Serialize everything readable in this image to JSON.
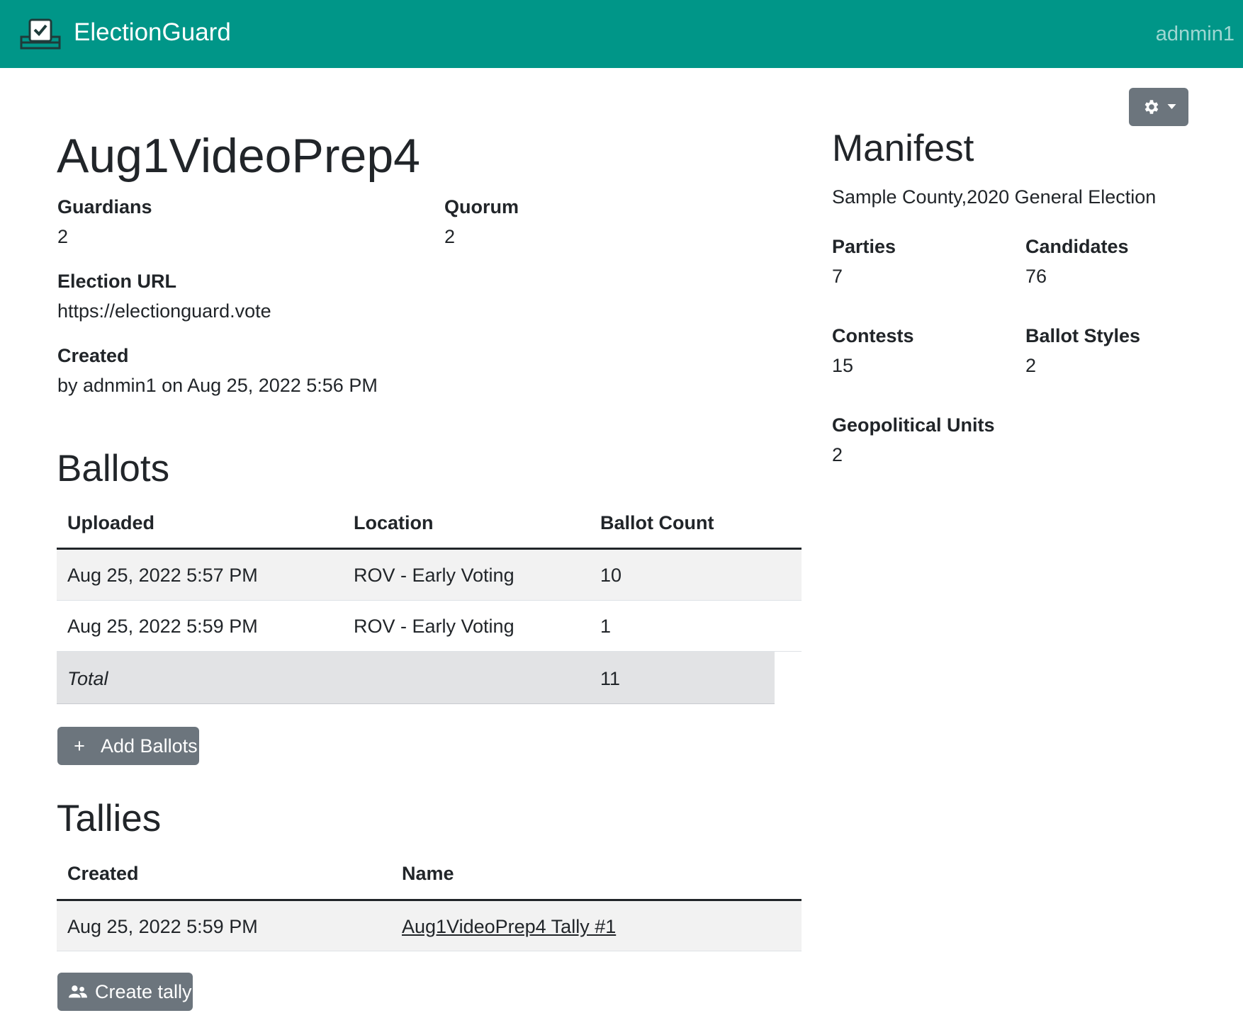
{
  "navbar": {
    "brand": "ElectionGuard",
    "user": "adnmin1"
  },
  "election": {
    "title": "Aug1VideoPrep4",
    "guardians_label": "Guardians",
    "guardians_value": "2",
    "quorum_label": "Quorum",
    "quorum_value": "2",
    "url_label": "Election URL",
    "url_value": "https://electionguard.vote",
    "created_label": "Created",
    "created_value": "by adnmin1 on Aug 25, 2022 5:56 PM"
  },
  "ballots": {
    "title": "Ballots",
    "headers": [
      "Uploaded",
      "Location",
      "Ballot Count"
    ],
    "rows": [
      [
        "Aug 25, 2022 5:57 PM",
        "ROV - Early Voting",
        "10"
      ],
      [
        "Aug 25, 2022 5:59 PM",
        "ROV - Early Voting",
        "1"
      ]
    ],
    "total_label": "Total",
    "total_value": "11",
    "add_button": "Add Ballots",
    "add_button_icon": "+"
  },
  "tallies": {
    "title": "Tallies",
    "headers": [
      "Created",
      "Name"
    ],
    "rows": [
      [
        "Aug 25, 2022 5:59 PM",
        "Aug1VideoPrep4 Tally #1"
      ]
    ],
    "create_button": "Create tally"
  },
  "manifest": {
    "title": "Manifest",
    "subtitle": "Sample County,2020 General Election",
    "parties_label": "Parties",
    "parties_value": "7",
    "candidates_label": "Candidates",
    "candidates_value": "76",
    "contests_label": "Contests",
    "contests_value": "15",
    "ballot_styles_label": "Ballot Styles",
    "ballot_styles_value": "2",
    "geo_label": "Geopolitical Units",
    "geo_value": "2"
  },
  "colors": {
    "navbar": "#009688",
    "button_secondary": "#6c757d",
    "link": "#0d6efd"
  },
  "icons": {
    "brand": "ballot-box-icon",
    "settings": "gear-icon",
    "add": "plus-icon",
    "create_tally": "people-icon"
  }
}
